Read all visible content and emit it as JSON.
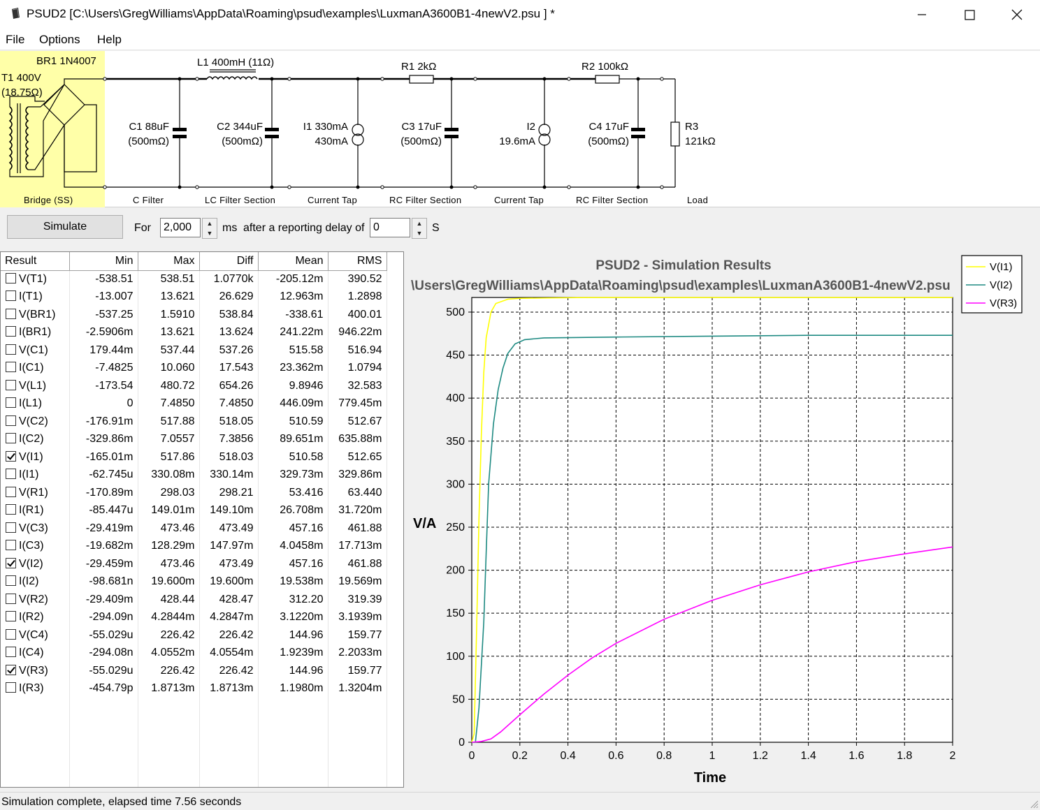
{
  "window": {
    "title": "PSUD2  [C:\\Users\\GregWilliams\\AppData\\Roaming\\psud\\examples\\LuxmanA3600B1-4newV2.psu ] *",
    "minimize_icon": "minimize-icon",
    "maximize_icon": "maximize-icon",
    "close_icon": "close-icon"
  },
  "menu": [
    "File",
    "Options",
    "Help"
  ],
  "schematic": {
    "transformer": [
      "T1 400V",
      "(18.75Ω)"
    ],
    "bridge": "BR1 1N4007",
    "l1": "L1 400mH (11Ω)",
    "r1": "R1 2kΩ",
    "r2": "R2 100kΩ",
    "c1": [
      "C1 88uF",
      "(500mΩ)"
    ],
    "c2": [
      "C2 344uF",
      "(500mΩ)"
    ],
    "i1": [
      "I1 330mA",
      "430mA"
    ],
    "c3": [
      "C3 17uF",
      "(500mΩ)"
    ],
    "i2": [
      "I2",
      "19.6mA"
    ],
    "c4": [
      "C4 17uF",
      "(500mΩ)"
    ],
    "r3": [
      "R3",
      "121kΩ"
    ],
    "sections": [
      "Bridge (SS)",
      "C Filter",
      "LC Filter Section",
      "Current Tap",
      "RC Filter Section",
      "Current Tap",
      "RC Filter Section",
      "Load"
    ],
    "bridge_color": "#ffffa8"
  },
  "controls": {
    "simulate": "Simulate",
    "for_label": "For",
    "duration": "2,000",
    "ms_label": "ms",
    "delay_label": "after a reporting delay of",
    "delay": "0",
    "s_label": "S"
  },
  "results": {
    "headers": [
      "Result",
      "Min",
      "Max",
      "Diff",
      "Mean",
      "RMS"
    ],
    "rows": [
      {
        "name": "V(T1)",
        "checked": false,
        "min": "-538.51",
        "max": "538.51",
        "diff": "1.0770k",
        "mean": "-205.12m",
        "rms": "390.52"
      },
      {
        "name": "I(T1)",
        "checked": false,
        "min": "-13.007",
        "max": "13.621",
        "diff": "26.629",
        "mean": "12.963m",
        "rms": "1.2898"
      },
      {
        "name": "V(BR1)",
        "checked": false,
        "min": "-537.25",
        "max": "1.5910",
        "diff": "538.84",
        "mean": "-338.61",
        "rms": "400.01"
      },
      {
        "name": "I(BR1)",
        "checked": false,
        "min": "-2.5906m",
        "max": "13.621",
        "diff": "13.624",
        "mean": "241.22m",
        "rms": "946.22m"
      },
      {
        "name": "V(C1)",
        "checked": false,
        "min": "179.44m",
        "max": "537.44",
        "diff": "537.26",
        "mean": "515.58",
        "rms": "516.94"
      },
      {
        "name": "I(C1)",
        "checked": false,
        "min": "-7.4825",
        "max": "10.060",
        "diff": "17.543",
        "mean": "23.362m",
        "rms": "1.0794"
      },
      {
        "name": "V(L1)",
        "checked": false,
        "min": "-173.54",
        "max": "480.72",
        "diff": "654.26",
        "mean": "9.8946",
        "rms": "32.583"
      },
      {
        "name": "I(L1)",
        "checked": false,
        "min": "0",
        "max": "7.4850",
        "diff": "7.4850",
        "mean": "446.09m",
        "rms": "779.45m"
      },
      {
        "name": "V(C2)",
        "checked": false,
        "min": "-176.91m",
        "max": "517.88",
        "diff": "518.05",
        "mean": "510.59",
        "rms": "512.67"
      },
      {
        "name": "I(C2)",
        "checked": false,
        "min": "-329.86m",
        "max": "7.0557",
        "diff": "7.3856",
        "mean": "89.651m",
        "rms": "635.88m"
      },
      {
        "name": "V(I1)",
        "checked": true,
        "min": "-165.01m",
        "max": "517.86",
        "diff": "518.03",
        "mean": "510.58",
        "rms": "512.65"
      },
      {
        "name": "I(I1)",
        "checked": false,
        "min": "-62.745u",
        "max": "330.08m",
        "diff": "330.14m",
        "mean": "329.73m",
        "rms": "329.86m"
      },
      {
        "name": "V(R1)",
        "checked": false,
        "min": "-170.89m",
        "max": "298.03",
        "diff": "298.21",
        "mean": "53.416",
        "rms": "63.440"
      },
      {
        "name": "I(R1)",
        "checked": false,
        "min": "-85.447u",
        "max": "149.01m",
        "diff": "149.10m",
        "mean": "26.708m",
        "rms": "31.720m"
      },
      {
        "name": "V(C3)",
        "checked": false,
        "min": "-29.419m",
        "max": "473.46",
        "diff": "473.49",
        "mean": "457.16",
        "rms": "461.88"
      },
      {
        "name": "I(C3)",
        "checked": false,
        "min": "-19.682m",
        "max": "128.29m",
        "diff": "147.97m",
        "mean": "4.0458m",
        "rms": "17.713m"
      },
      {
        "name": "V(I2)",
        "checked": true,
        "min": "-29.459m",
        "max": "473.46",
        "diff": "473.49",
        "mean": "457.16",
        "rms": "461.88"
      },
      {
        "name": "I(I2)",
        "checked": false,
        "min": "-98.681n",
        "max": "19.600m",
        "diff": "19.600m",
        "mean": "19.538m",
        "rms": "19.569m"
      },
      {
        "name": "V(R2)",
        "checked": false,
        "min": "-29.409m",
        "max": "428.44",
        "diff": "428.47",
        "mean": "312.20",
        "rms": "319.39"
      },
      {
        "name": "I(R2)",
        "checked": false,
        "min": "-294.09n",
        "max": "4.2844m",
        "diff": "4.2847m",
        "mean": "3.1220m",
        "rms": "3.1939m"
      },
      {
        "name": "V(C4)",
        "checked": false,
        "min": "-55.029u",
        "max": "226.42",
        "diff": "226.42",
        "mean": "144.96",
        "rms": "159.77"
      },
      {
        "name": "I(C4)",
        "checked": false,
        "min": "-294.08n",
        "max": "4.0552m",
        "diff": "4.0554m",
        "mean": "1.9239m",
        "rms": "2.2033m"
      },
      {
        "name": "V(R3)",
        "checked": true,
        "min": "-55.029u",
        "max": "226.42",
        "diff": "226.42",
        "mean": "144.96",
        "rms": "159.77"
      },
      {
        "name": "I(R3)",
        "checked": false,
        "min": "-454.79p",
        "max": "1.8713m",
        "diff": "1.8713m",
        "mean": "1.1980m",
        "rms": "1.3204m"
      }
    ]
  },
  "chart_data": {
    "type": "line",
    "title": "PSUD2 - Simulation Results",
    "subtitle": "\\Users\\GregWilliams\\AppData\\Roaming\\psud\\examples\\LuxmanA3600B1-4newV2.psu",
    "xlabel": "Time",
    "ylabel": "V/A",
    "xlim": [
      0,
      2
    ],
    "ylim": [
      0,
      517
    ],
    "xticks": [
      "0",
      "0.2",
      "0.4",
      "0.6",
      "0.8",
      "1",
      "1.2",
      "1.4",
      "1.6",
      "1.8",
      "2"
    ],
    "yticks": [
      "0",
      "50",
      "100",
      "150",
      "200",
      "250",
      "300",
      "350",
      "400",
      "450",
      "500"
    ],
    "grid": true,
    "legend_position": "top-right",
    "series": [
      {
        "name": "V(I1)",
        "color": "#ffff00",
        "points": [
          [
            0,
            0
          ],
          [
            0.01,
            10
          ],
          [
            0.02,
            130
          ],
          [
            0.03,
            260
          ],
          [
            0.04,
            360
          ],
          [
            0.05,
            430
          ],
          [
            0.06,
            470
          ],
          [
            0.08,
            500
          ],
          [
            0.1,
            510
          ],
          [
            0.15,
            515
          ],
          [
            0.2,
            516
          ],
          [
            0.5,
            517
          ],
          [
            1,
            517
          ],
          [
            1.5,
            517
          ],
          [
            2,
            517
          ]
        ]
      },
      {
        "name": "V(I2)",
        "color": "#1e8a82",
        "points": [
          [
            0,
            0
          ],
          [
            0.015,
            0
          ],
          [
            0.03,
            40
          ],
          [
            0.05,
            140
          ],
          [
            0.06,
            220
          ],
          [
            0.07,
            300
          ],
          [
            0.09,
            370
          ],
          [
            0.11,
            410
          ],
          [
            0.13,
            435
          ],
          [
            0.15,
            452
          ],
          [
            0.18,
            463
          ],
          [
            0.22,
            468
          ],
          [
            0.3,
            470
          ],
          [
            0.6,
            471
          ],
          [
            1,
            472
          ],
          [
            1.4,
            473
          ],
          [
            2,
            473
          ]
        ]
      },
      {
        "name": "V(R3)",
        "color": "#ff00ff",
        "points": [
          [
            0,
            0
          ],
          [
            0.04,
            1
          ],
          [
            0.08,
            4
          ],
          [
            0.12,
            12
          ],
          [
            0.2,
            32
          ],
          [
            0.3,
            56
          ],
          [
            0.4,
            78
          ],
          [
            0.5,
            98
          ],
          [
            0.6,
            115
          ],
          [
            0.8,
            143
          ],
          [
            1,
            165
          ],
          [
            1.2,
            183
          ],
          [
            1.4,
            198
          ],
          [
            1.6,
            210
          ],
          [
            1.8,
            219
          ],
          [
            2,
            227
          ]
        ]
      }
    ]
  },
  "status": "Simulation complete, elapsed time 7.56 seconds"
}
